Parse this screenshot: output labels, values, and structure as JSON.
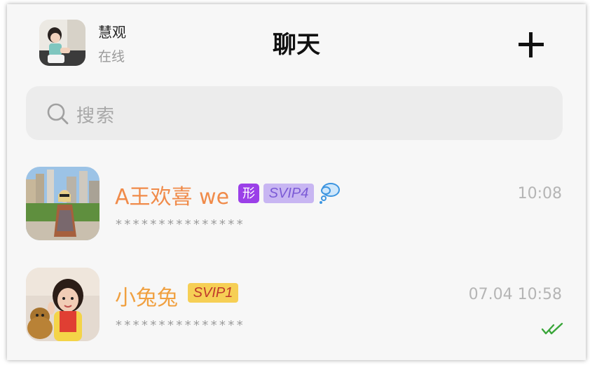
{
  "header": {
    "user_name": "慧观",
    "user_status": "在线",
    "title": "聊天"
  },
  "search": {
    "placeholder": "搜索"
  },
  "chats": [
    {
      "name": "A王欢喜 we",
      "name_color": "#f08b4a",
      "badges": [
        "形",
        "SVIP4"
      ],
      "preview": "***************",
      "time": "10:08"
    },
    {
      "name": "小兔兔",
      "name_color": "#f0a040",
      "badges": [
        "SVIP1"
      ],
      "preview": "***************",
      "time": "07.04 10:58",
      "status_icon": "double-check-icon"
    }
  ],
  "colors": {
    "background": "#f7f7f7",
    "search_bg": "#ececec",
    "svip4_bg": "#c8b6f2",
    "svip1_bg": "#f6cf55",
    "read_check": "#3aa63a"
  }
}
